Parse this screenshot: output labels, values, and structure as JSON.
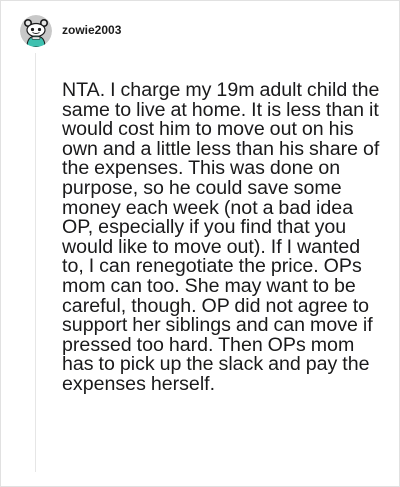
{
  "comment": {
    "author": "zowie2003",
    "avatar_icon": "snoo-avatar-icon",
    "body": "NTA. I charge my 19m adult child the same to live at home. It is less than it would cost him to move out on his own and a little less than his share of the expenses. This was done on purpose, so he could save some money each week (not a bad idea OP, especially if you find that you would like to move out). If I wanted to, I can renegotiate the price. OPs mom can too. She may want to be careful, though. OP did not agree to support her siblings and can move if pressed too hard. Then OPs mom has to pick up the slack and pay the expenses herself."
  },
  "colors": {
    "avatar_bg": "#c8c8c8",
    "avatar_body": "#3fc1b0",
    "thread_line": "#e6e6e6",
    "text": "#1a1a1b"
  }
}
